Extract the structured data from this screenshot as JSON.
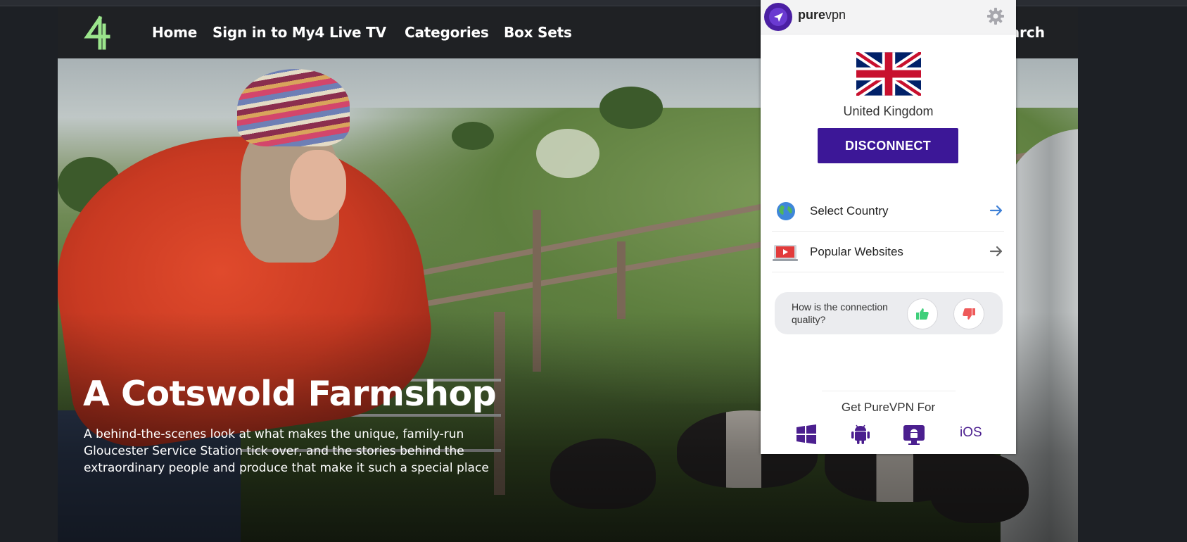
{
  "site": {
    "nav": {
      "home": "Home",
      "sign_in": "Sign in to My4",
      "live_tv": "Live TV",
      "categories": "Categories",
      "box_sets": "Box Sets",
      "search_partial": "earch"
    },
    "hero": {
      "title": "A Cotswold Farmshop",
      "description_lines": [
        "A behind-the-scenes look at what makes the unique, family-run",
        "Gloucester Service Station tick over, and the stories behind the",
        "extraordinary people and produce that make it such a special place"
      ]
    }
  },
  "vpn": {
    "brand_bold": "pure",
    "brand_regular": "vpn",
    "country": "United Kingdom",
    "disconnect_label": "DISCONNECT",
    "menu": [
      {
        "label": "Select Country",
        "icon": "globe-icon"
      },
      {
        "label": "Popular Websites",
        "icon": "video-icon"
      }
    ],
    "feedback_question": "How is the connection quality?",
    "get_for": "Get PureVPN For",
    "platforms": [
      "windows-icon",
      "android-icon",
      "android-tv-icon"
    ],
    "ios_label": "iOS",
    "colors": {
      "accent": "#3c1797",
      "thumbs_up": "#3ecf7a",
      "thumbs_down": "#ee5a5a",
      "arrow_blue": "#3d7fd6"
    }
  }
}
